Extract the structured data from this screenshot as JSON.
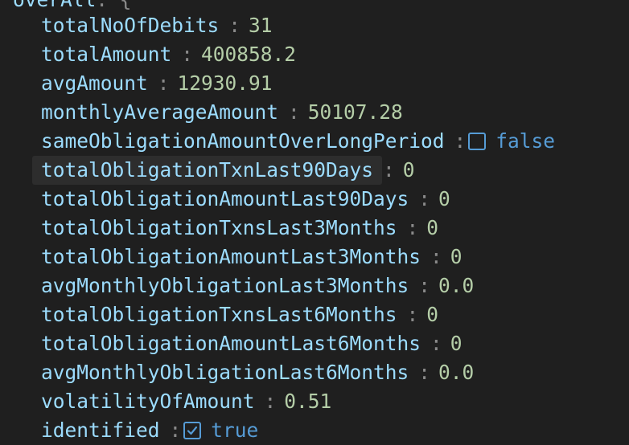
{
  "parent": {
    "key": "overAll",
    "punct": ": {"
  },
  "rows": [
    {
      "key": "totalNoOfDebits",
      "value": "31",
      "type": "number"
    },
    {
      "key": "totalAmount",
      "value": "400858.2",
      "type": "number"
    },
    {
      "key": "avgAmount",
      "value": "12930.91",
      "type": "number"
    },
    {
      "key": "monthlyAverageAmount",
      "value": "50107.28",
      "type": "number"
    },
    {
      "key": "sameObligationAmountOverLongPeriod",
      "value": "false",
      "type": "boolean",
      "checked": false
    },
    {
      "key": "totalObligationTxnLast90Days",
      "value": "0",
      "type": "number",
      "hovered": true
    },
    {
      "key": "totalObligationAmountLast90Days",
      "value": "0",
      "type": "number"
    },
    {
      "key": "totalObligationTxnsLast3Months",
      "value": "0",
      "type": "number"
    },
    {
      "key": "totalObligationAmountLast3Months",
      "value": "0",
      "type": "number"
    },
    {
      "key": "avgMonthlyObligationLast3Months",
      "value": "0.0",
      "type": "number"
    },
    {
      "key": "totalObligationTxnsLast6Months",
      "value": "0",
      "type": "number"
    },
    {
      "key": "totalObligationAmountLast6Months",
      "value": "0",
      "type": "number"
    },
    {
      "key": "avgMonthlyObligationLast6Months",
      "value": "0.0",
      "type": "number"
    },
    {
      "key": "volatilityOfAmount",
      "value": "0.51",
      "type": "number"
    },
    {
      "key": "identified",
      "value": "true",
      "type": "boolean",
      "checked": true
    }
  ],
  "colon": ":",
  "colors": {
    "background": "#1f1f1f",
    "key": "#9cdcfe",
    "number": "#b5cea8",
    "boolean": "#569cd6",
    "punctuation": "#8a8a8a"
  }
}
